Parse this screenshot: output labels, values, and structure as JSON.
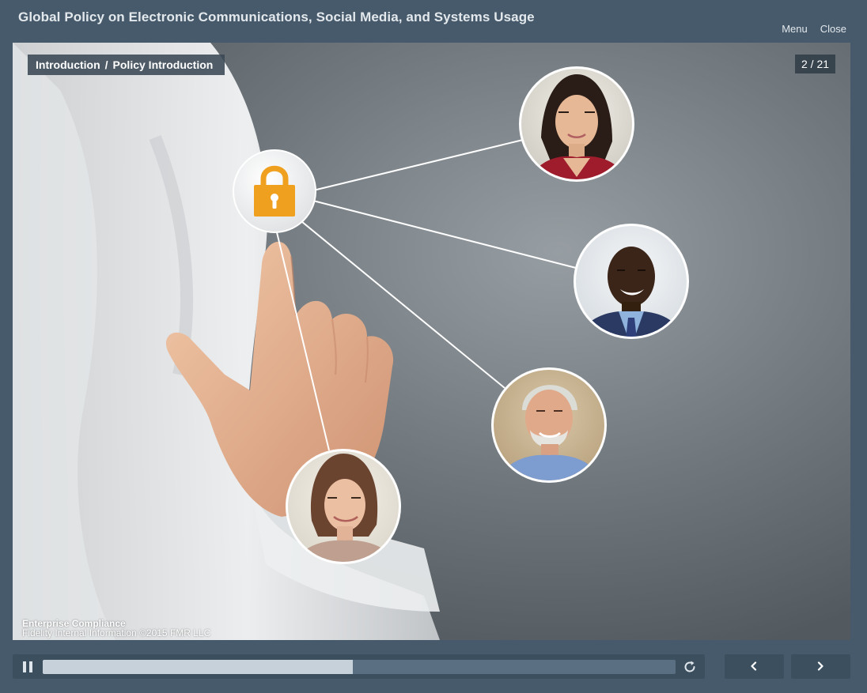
{
  "header": {
    "title": "Global Policy on Electronic Communications, Social Media, and Systems Usage",
    "menu_label": "Menu",
    "close_label": "Close"
  },
  "slide": {
    "breadcrumb": {
      "section": "Introduction",
      "separator": "/",
      "page": "Policy Introduction"
    },
    "counter": "2 / 21",
    "footer": {
      "org": "Enterprise Compliance",
      "legal": "Fidelity Internal Information ©2015 FMR LLC"
    },
    "icons": [
      "padlock-icon",
      "person-avatar-woman",
      "person-avatar-man",
      "person-avatar-older-man",
      "person-avatar-woman-2"
    ]
  },
  "player": {
    "progress": 0.49,
    "buttons": [
      "pause-icon",
      "replay-icon",
      "previous-chevron-icon",
      "next-chevron-icon"
    ]
  },
  "colors": {
    "chrome": "#465a6b",
    "lock": "#f0a01f",
    "progress_fill": "#c7d1d9",
    "progress_track": "#5a6f82"
  }
}
